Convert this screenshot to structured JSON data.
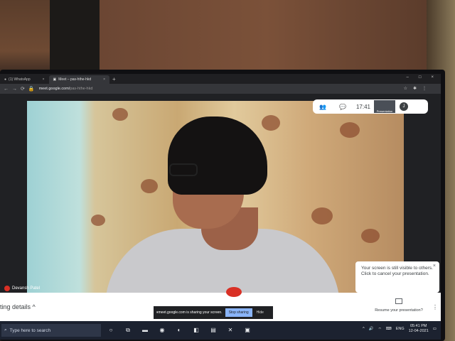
{
  "browser": {
    "tabs": [
      {
        "label": "(1) WhatsApp",
        "close": "×"
      },
      {
        "label": "Meet – pas-hthe-hkd",
        "close": "×"
      }
    ],
    "new_tab": "+",
    "url_host": "meet.google.com/",
    "url_path": "pas-hthe-hkd",
    "nav": {
      "back": "←",
      "forward": "→",
      "reload": "⟳"
    },
    "window_controls": {
      "minimize": "–",
      "maximize": "□",
      "close": "×"
    }
  },
  "meet": {
    "time": "17:41",
    "self_view_label": "Presentation",
    "avatar_letter": "J",
    "participant_name": "Devansh Patel",
    "tooltip_text": "Your screen is still visible to others. Click to cancel your presentation.",
    "tooltip_close": "×",
    "meeting_details": "ting details",
    "sharing_text": "meet.google.com is sharing your screen.",
    "stop_sharing": "Stop sharing",
    "hide": "Hide",
    "resume_label": "Resume your presentation?"
  },
  "taskbar": {
    "search_placeholder": "Type here to search",
    "language": "ENG",
    "time": "05:41 PM",
    "date": "12-04-2021"
  }
}
